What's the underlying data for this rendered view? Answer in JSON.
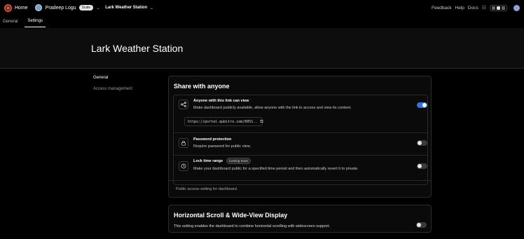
{
  "topbar": {
    "home_label": "Home",
    "workspace_name": "Pradeep Logu",
    "plan_badge": "Scale",
    "project_name": "Lark Weather Station",
    "links": [
      "Feedback",
      "Help",
      "Docs"
    ]
  },
  "tabs": [
    {
      "label": "General"
    },
    {
      "label": "Settings",
      "active": true
    }
  ],
  "page": {
    "title": "Lark Weather Station"
  },
  "sidebar": {
    "items": [
      {
        "label": "General",
        "active": true
      },
      {
        "label": "Access management"
      }
    ]
  },
  "share": {
    "title": "Share with anyone",
    "link_row": {
      "title": "Anyone with this link can view",
      "description": "Make dashboard publicly available, allow anyone with the link to access and view its content.",
      "url": "https://portal.qubitro.com/6051..",
      "enabled": true
    },
    "password_row": {
      "title": "Password protection",
      "description": "Require password for public view.",
      "enabled": false
    },
    "time_row": {
      "title": "Lock time range",
      "badge": "Coming Soon",
      "description": "Make your dashboard public for a specified time period and then automatically revert it to private.",
      "enabled": false
    },
    "footer": "Public access setting for dashboard."
  },
  "scroll": {
    "title": "Horizontal Scroll & Wide-View Display",
    "description": "This setting enables the dashboard to combine horizontal scrolling with widescreen support.",
    "enabled": false
  },
  "icons": {
    "logo": "brand-logo-icon",
    "share": "share-icon",
    "lock": "lock-icon",
    "clock": "clock-icon",
    "copy": "copy-icon"
  },
  "colors": {
    "accent": "#2f74e0",
    "logo": "#e8552a"
  }
}
